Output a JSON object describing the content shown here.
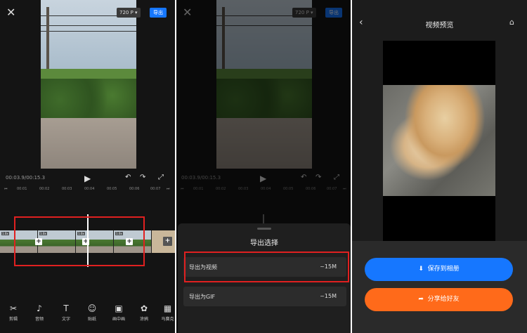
{
  "editor": {
    "resolution": "720 P",
    "export_label": "导出",
    "timecode": "00:03.9/00:15.3",
    "ruler_ticks": [
      "00:01",
      "00:02",
      "00:03",
      "00:04",
      "00:05",
      "00:06",
      "00:07"
    ],
    "clip_speed": "1.0x",
    "tools": [
      {
        "label": "剪辑",
        "icon": "✂"
      },
      {
        "label": "音频",
        "icon": "♪"
      },
      {
        "label": "文字",
        "icon": "T"
      },
      {
        "label": "贴纸",
        "icon": "☺"
      },
      {
        "label": "画中画",
        "icon": "▣"
      },
      {
        "label": "涂鸦",
        "icon": "✿"
      },
      {
        "label": "马赛克",
        "icon": "▦"
      }
    ]
  },
  "export_sheet": {
    "title": "导出选择",
    "options": [
      {
        "label": "导出为视频",
        "size": "~15M"
      },
      {
        "label": "导出为GIF",
        "size": "~15M"
      }
    ]
  },
  "preview": {
    "title": "视频预览",
    "save_label": "保存到相册",
    "share_label": "分享给好友",
    "save_color": "#1677ff",
    "share_color": "#ff6a1a"
  },
  "colors": {
    "accent": "#1677ff",
    "highlight": "#e02020"
  }
}
